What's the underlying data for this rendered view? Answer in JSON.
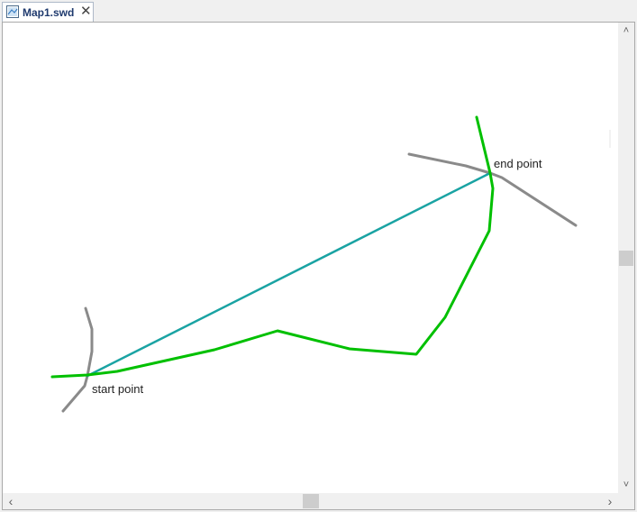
{
  "tab": {
    "title": "Map1.swd",
    "icon": "map-document-icon",
    "close_icon": "close-icon",
    "close_glyph": "✕"
  },
  "map": {
    "start_label": "start point",
    "end_label": "end point",
    "colors": {
      "route": "#00c000",
      "straight_line": "#1aa3a3",
      "roads": "#8a8a8a"
    }
  },
  "scrollbars": {
    "up_glyph": "˄",
    "down_glyph": "˅",
    "left_glyph": "‹",
    "right_glyph": "›"
  }
}
